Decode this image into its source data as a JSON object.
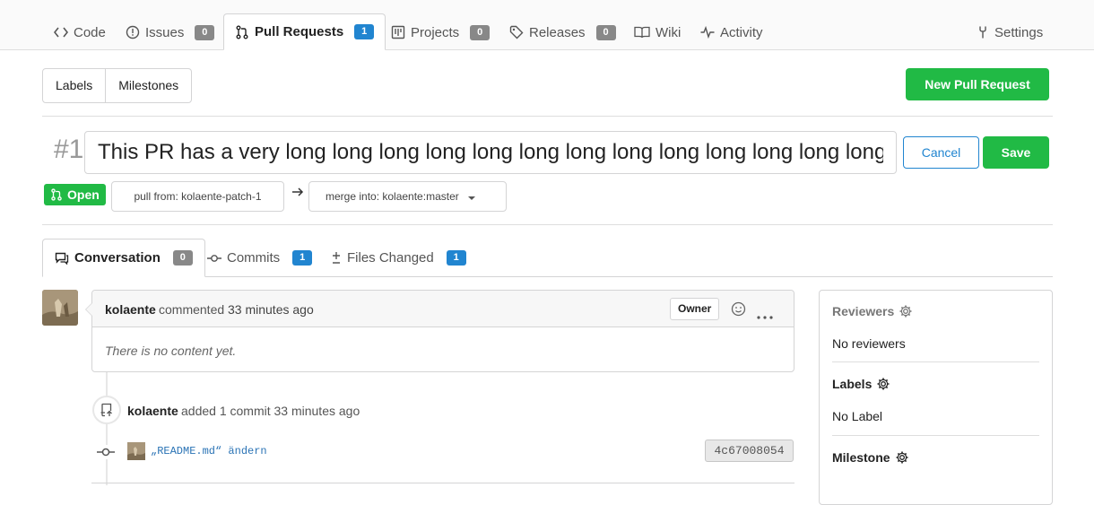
{
  "nav": {
    "code": "Code",
    "issues": "Issues",
    "issues_count": "0",
    "pulls": "Pull Requests",
    "pulls_count": "1",
    "projects": "Projects",
    "projects_count": "0",
    "releases": "Releases",
    "releases_count": "0",
    "wiki": "Wiki",
    "activity": "Activity",
    "settings": "Settings"
  },
  "toolbar": {
    "labels": "Labels",
    "milestones": "Milestones",
    "new_pr": "New Pull Request"
  },
  "pr": {
    "index": "#1",
    "title": "This PR has a very long long long long long long long long long long long long long long long long long long long long long long long long long long long long long long long long long long long long long long long long long long long long long long long long long long long long long long long long long title",
    "cancel": "Cancel",
    "save": "Save",
    "state": "Open",
    "pull_from": "pull from: kolaente-patch-1",
    "merge_into": "merge into: kolaente:master"
  },
  "tabs": {
    "conversation": "Conversation",
    "conversation_count": "0",
    "commits": "Commits",
    "commits_count": "1",
    "files": "Files Changed",
    "files_count": "1"
  },
  "comment": {
    "author": "kolaente",
    "action": "commented",
    "time": "33 minutes ago",
    "role": "Owner",
    "body": "There is no content yet."
  },
  "event": {
    "author": "kolaente",
    "text": "added 1 commit 33 minutes ago",
    "commit_message": "„README.md“ ändern",
    "commit_sha": "4c67008054"
  },
  "sidebar": {
    "reviewers": "Reviewers",
    "reviewers_value": "No reviewers",
    "labels": "Labels",
    "labels_value": "No Label",
    "milestone": "Milestone"
  },
  "colors": {
    "green": "#21ba45",
    "blue": "#2185d0",
    "count_grey": "#888888"
  }
}
